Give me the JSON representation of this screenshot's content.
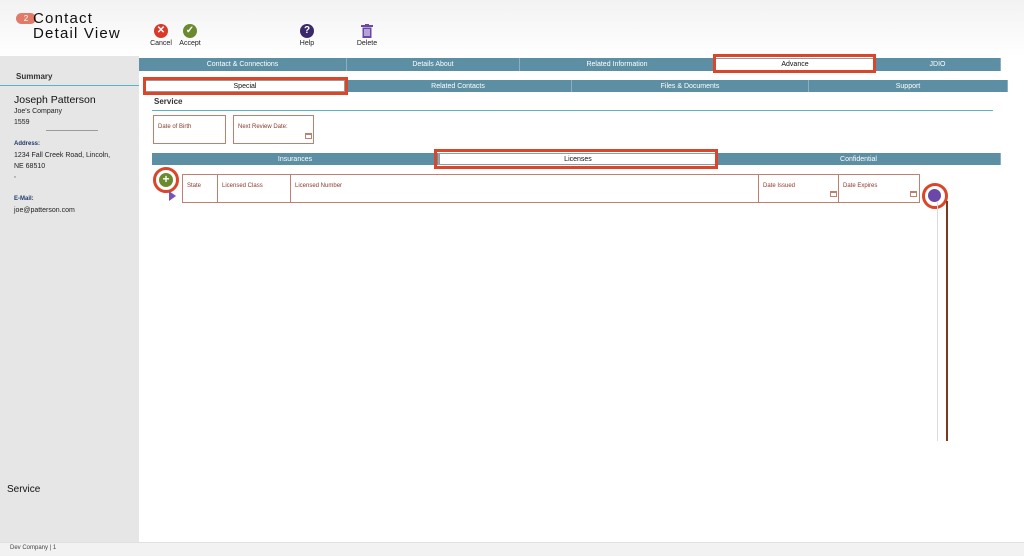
{
  "header": {
    "badge": "2",
    "title_line1": "Contact",
    "title_line2": "Detail View",
    "toolbar": [
      {
        "label": "Cancel",
        "icon": "cancel-icon",
        "color": "#d9392a",
        "glyph": "✕"
      },
      {
        "label": "Accept",
        "icon": "accept-icon",
        "color": "#6b8a2f",
        "glyph": "✓"
      },
      {
        "label": "Help",
        "icon": "help-icon",
        "color": "#3b2a6b",
        "glyph": "?"
      },
      {
        "label": "Delete",
        "icon": "trash-icon",
        "color": "#6a48a8",
        "glyph": ""
      }
    ]
  },
  "sidebar": {
    "summary_label": "Summary",
    "name": "Joseph Patterson",
    "company": "Joe's Company",
    "number": "1559",
    "divider_text": "--------------------------",
    "address_label": "Address:",
    "address_line1": "1234 Fall Creek Road, Lincoln,",
    "address_line2": "NE  68510",
    "address_line3": ",",
    "email_label": "E-Mail:",
    "email": "joe@patterson.com",
    "bottom_label": "Service"
  },
  "main_tabs": [
    {
      "label": "Contact & Connections",
      "active": false
    },
    {
      "label": "Details About",
      "active": false
    },
    {
      "label": "Related Information",
      "active": false
    },
    {
      "label": "Advance",
      "active": true
    },
    {
      "label": "JDIO",
      "active": false
    }
  ],
  "sub_tabs": [
    {
      "label": "Special",
      "active": true
    },
    {
      "label": "Related Contacts",
      "active": false
    },
    {
      "label": "Files & Documents",
      "active": false
    },
    {
      "label": "Support",
      "active": false
    }
  ],
  "section_title": "Service",
  "fields": {
    "date_of_birth": "Date of Birth",
    "next_review_date": "Next Review Date:"
  },
  "inner_tabs": [
    {
      "label": "Insurances",
      "active": false
    },
    {
      "label": "Licenses",
      "active": true
    },
    {
      "label": "Confidential",
      "active": false
    }
  ],
  "license_columns": [
    "State",
    "Licensed Class",
    "Licensed Number",
    "Date Issued",
    "Date Expires"
  ],
  "footer": "Dev Company | 1",
  "colors": {
    "tab_bg": "#5c8fa3",
    "highlight": "#d9462a",
    "field_border": "#c08070",
    "accent_line": "#5ab4c8"
  }
}
